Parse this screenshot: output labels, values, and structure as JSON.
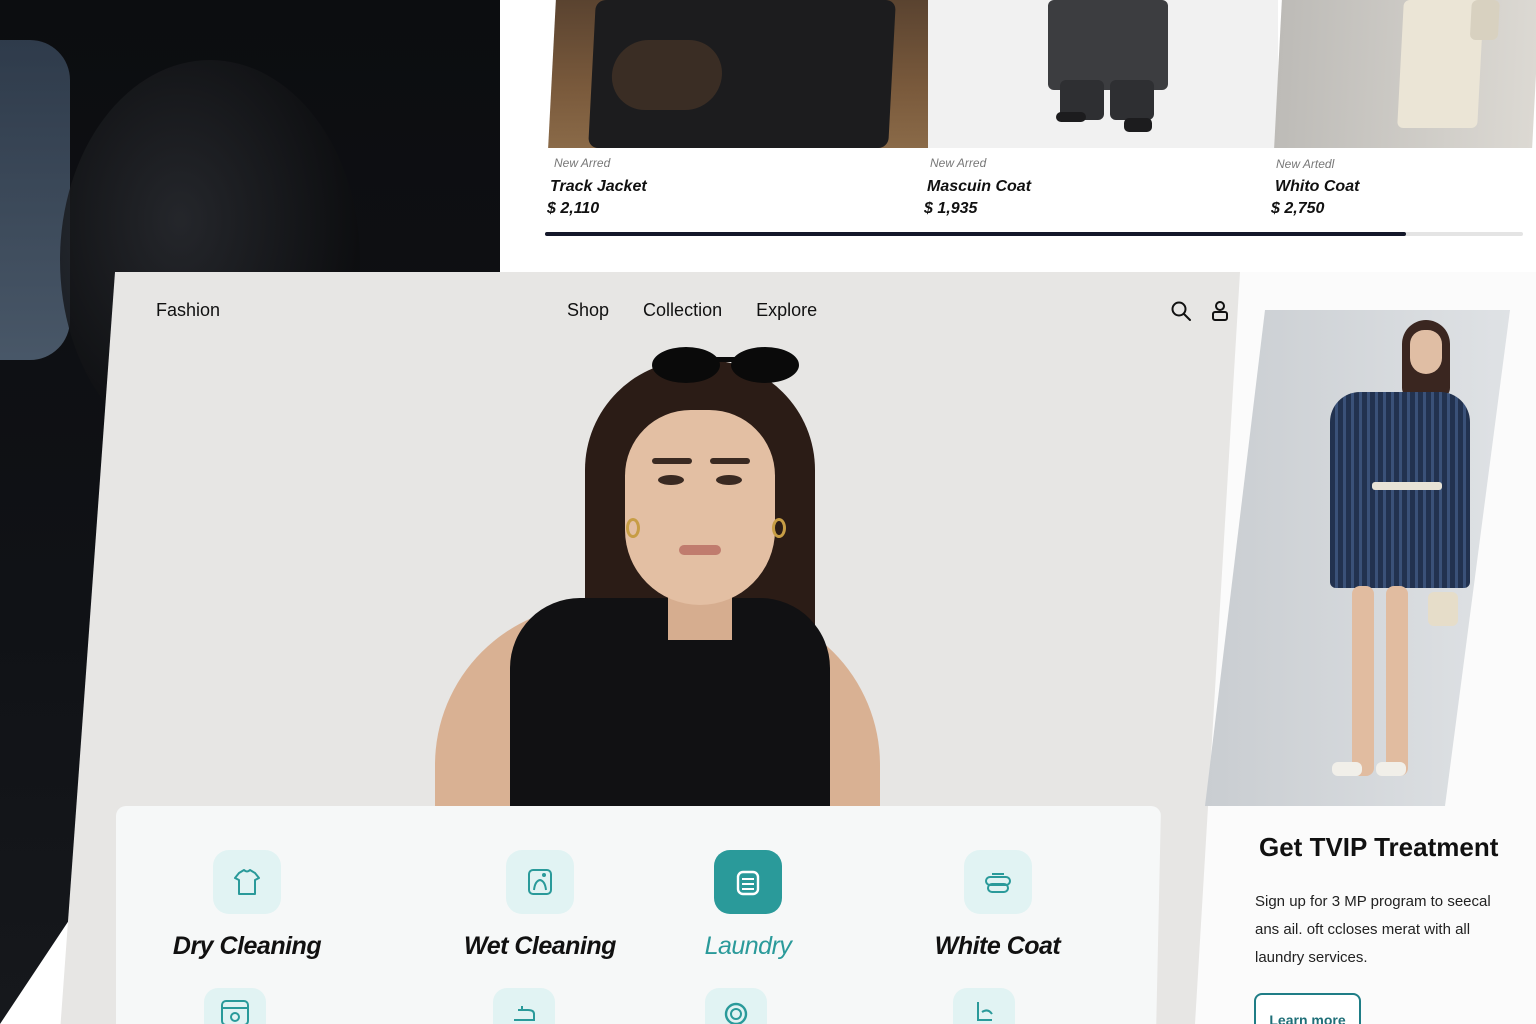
{
  "products": [
    {
      "tag": "New Arred",
      "name": "Track Jacket",
      "price": "$ 2,110"
    },
    {
      "tag": "New Arred",
      "name": "Mascuin Coat",
      "price": "$ 1,935"
    },
    {
      "tag": "New Artedl",
      "name": "Whito Coat",
      "price": "$ 2,750"
    }
  ],
  "carousel_progress": 0.88,
  "nav": {
    "brand": "Fashion",
    "links": [
      "Shop",
      "Collection",
      "Explore"
    ],
    "icons": [
      "search-icon",
      "user-icon"
    ]
  },
  "services": [
    {
      "label": "Dry Cleaning",
      "icon": "shirt-icon",
      "active": false
    },
    {
      "label": "Wet Cleaning",
      "icon": "washing-icon",
      "active": false
    },
    {
      "label": "Laundry",
      "icon": "laundry-basket-icon",
      "active": true
    },
    {
      "label": "White Coat",
      "icon": "folded-clothes-icon",
      "active": false
    }
  ],
  "services_more_icons": [
    "washing-machine-icon",
    "iron-icon",
    "dryer-icon",
    "steamer-icon"
  ],
  "vip": {
    "title": "Get TVIP Treatment",
    "text": "Sign up for 3 MP program to seecal ans ail. oft ccloses merat with all laundry services.",
    "button": "Learn more"
  },
  "colors": {
    "accent": "#2a9a9a",
    "button_border": "#1f7d86",
    "progress": "#14182a"
  }
}
